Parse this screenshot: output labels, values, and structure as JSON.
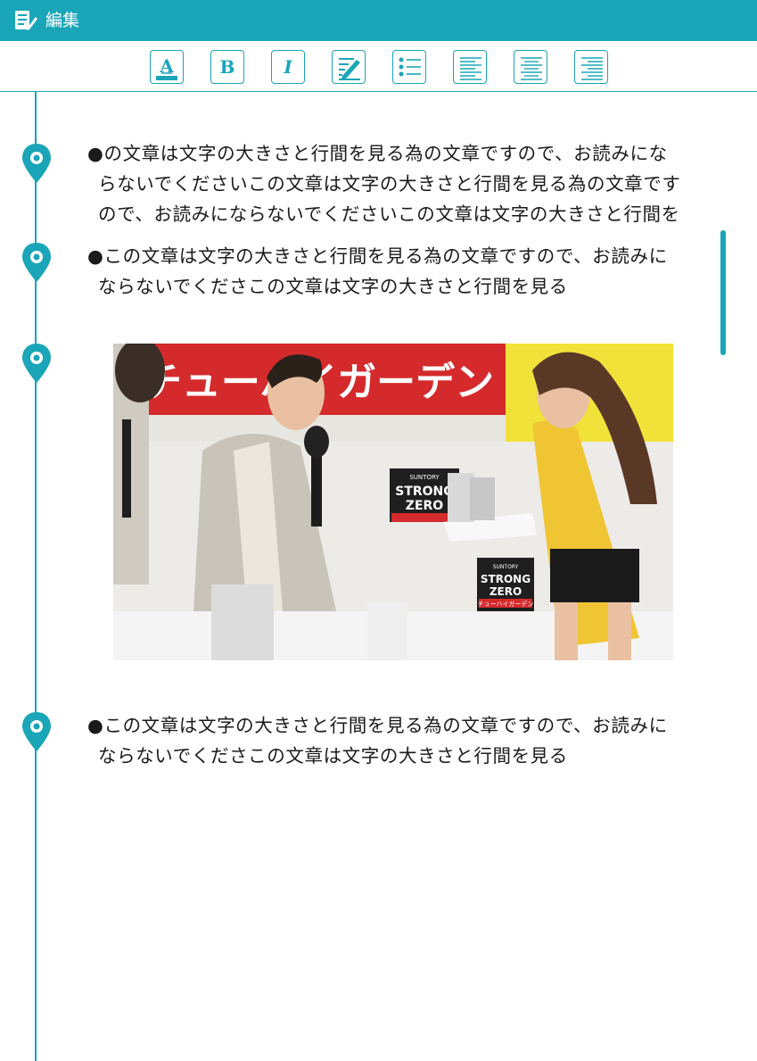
{
  "header": {
    "title": "編集",
    "icon": "edit-note-icon",
    "color": "#1aa5b8"
  },
  "toolbar": {
    "buttons": [
      {
        "id": "font-color",
        "label": "A",
        "icon": "font-color-icon"
      },
      {
        "id": "bold",
        "label": "B",
        "icon": "bold-icon"
      },
      {
        "id": "italic",
        "label": "I",
        "icon": "italic-icon"
      },
      {
        "id": "highlight",
        "label": "",
        "icon": "highlighter-icon"
      },
      {
        "id": "bullet-list",
        "label": "",
        "icon": "bullet-list-icon"
      },
      {
        "id": "align-left",
        "label": "",
        "icon": "align-left-icon"
      },
      {
        "id": "align-center",
        "label": "",
        "icon": "align-center-icon"
      },
      {
        "id": "align-right",
        "label": "",
        "icon": "align-right-icon"
      }
    ]
  },
  "entries": [
    {
      "lines": [
        "●の文章は文字の大きさと行間を見る為の文章ですので、お読みにな",
        "らないでくださいこの文章は文字の大きさと行間を見る為の文章です",
        "ので、お読みにならないでくださいこの文章は文字の大きさと行間を"
      ]
    },
    {
      "lines": [
        "●この文章は文字の大きさと行間を見る為の文章ですので、お読みに",
        "ならないでくださこの文章は文字の大きさと行間を見る"
      ]
    },
    {
      "image": "photo"
    },
    {
      "lines": [
        "●この文章は文字の大きさと行間を見る為の文章ですので、お読みに",
        "ならないでくださこの文章は文字の大きさと行間を見る"
      ]
    }
  ],
  "photo": {
    "banner_text": "チューハイガーデン",
    "product_brand": "SUNTORY",
    "product_name_line1": "STRONG",
    "product_name_line2": "ZERO",
    "product_sub": "チューハイガーデン"
  }
}
